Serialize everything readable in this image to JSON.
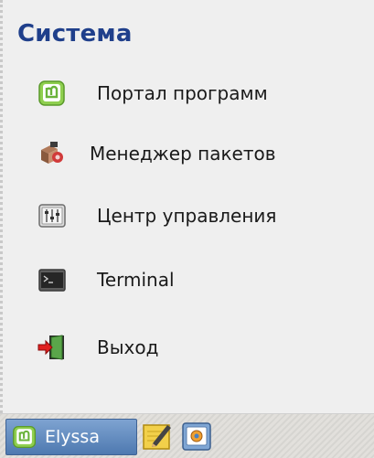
{
  "menu": {
    "section_title": "Система",
    "items": [
      {
        "label": "Портал программ",
        "icon": "mint-logo-icon"
      },
      {
        "label": "Менеджер пакетов",
        "icon": "package-manager-icon"
      },
      {
        "label": "Центр управления",
        "icon": "control-center-icon"
      },
      {
        "label": "Terminal",
        "icon": "terminal-icon"
      },
      {
        "label": "Выход",
        "icon": "logout-icon"
      }
    ]
  },
  "taskbar": {
    "start_label": "Elyssa",
    "start_icon": "mint-logo-icon",
    "launchers": [
      "text-editor-icon",
      "screenshot-icon"
    ]
  },
  "colors": {
    "title": "#1f3f8b",
    "menu_bg": "#efefef",
    "start_button": "#5a84bb",
    "mint_green": "#7fc24a"
  }
}
